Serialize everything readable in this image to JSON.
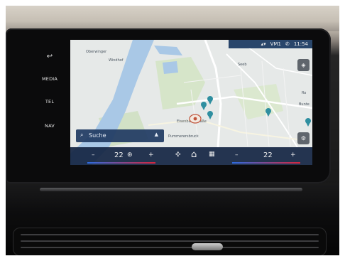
{
  "side_buttons": {
    "back": "↩",
    "media": "MEDIA",
    "tel": "TEL",
    "nav": "NAV"
  },
  "status": {
    "profile": "VM1",
    "time": "11:54"
  },
  "map": {
    "labels": [
      "Oberwinger",
      "Windhof",
      "Seeb",
      "Eisenbahnstraße",
      "Pummerersbruck",
      "Ro",
      "Bunte"
    ]
  },
  "search": {
    "label": "Suche"
  },
  "climate": {
    "left_minus": "–",
    "left_temp": "22",
    "left_plus": "+",
    "right_minus": "–",
    "right_temp": "22",
    "right_plus": "+"
  },
  "colors": {
    "water": "#a9c8e6",
    "green": "#d6e5c9",
    "bar": "#142442",
    "poi": "#2f8fa0",
    "heat_left": "#d7263d",
    "cool_left": "#2d6be0"
  },
  "icons": [
    "back-arrow-icon",
    "home-icon",
    "grid-icon",
    "fan-icon",
    "steering-heat-icon",
    "search-icon",
    "chevron-up-icon",
    "compass-icon",
    "location-pin-icon",
    "signal-icon"
  ]
}
